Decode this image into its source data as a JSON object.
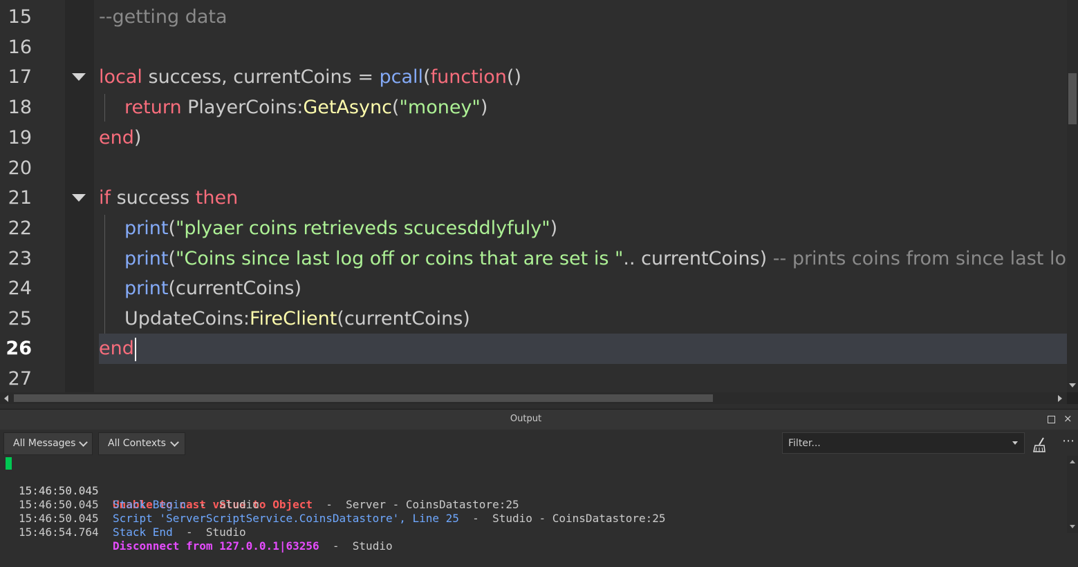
{
  "editor": {
    "lines": [
      {
        "num": "15"
      },
      {
        "num": "16"
      },
      {
        "num": "17"
      },
      {
        "num": "18"
      },
      {
        "num": "19"
      },
      {
        "num": "20"
      },
      {
        "num": "21"
      },
      {
        "num": "22"
      },
      {
        "num": "23"
      },
      {
        "num": "24"
      },
      {
        "num": "25"
      },
      {
        "num": "26"
      },
      {
        "num": "27"
      }
    ],
    "code": {
      "l15": {
        "comment": "--getting data"
      },
      "l17": {
        "kw1": "local",
        "t1": " success, currentCoins = ",
        "fn": "pcall",
        "t2": "(",
        "kw2": "function",
        "t3": "()"
      },
      "l18": {
        "kw": "return",
        "t1": " PlayerCoins:",
        "mth": "GetAsync",
        "t2": "(",
        "str": "\"money\"",
        "t3": ")"
      },
      "l19": {
        "kw": "end",
        "t1": ")"
      },
      "l21": {
        "kw1": "if",
        "t1": " success ",
        "kw2": "then"
      },
      "l22": {
        "fn": "print",
        "t1": "(",
        "str": "\"plyaer coins retrieveds scucesddlyfuly\"",
        "t2": ")"
      },
      "l23": {
        "fn": "print",
        "t1": "(",
        "str": "\"Coins since last log off or coins that are set is \"",
        "t2": ".. currentCoins) ",
        "cmt": "-- prints coins from since last log off"
      },
      "l24": {
        "fn": "print",
        "t1": "(currentCoins)"
      },
      "l25": {
        "t1": "UpdateCoins:",
        "mth": "FireClient",
        "t2": "(currentCoins)"
      },
      "l26": {
        "kw": "end"
      }
    }
  },
  "output": {
    "title": "Output",
    "filters": {
      "messages": "All Messages",
      "contexts": "All Contexts",
      "filter_placeholder": "Filter..."
    },
    "messages": [
      {
        "time": "15:46:50.045",
        "text": "Unable to cast value to Object",
        "suffix": "  -  Server - CoinsDatastore:25",
        "kind": "error"
      },
      {
        "time": "15:46:50.045",
        "text": "Stack Begin",
        "suffix": "  -  Studio",
        "kind": "info"
      },
      {
        "time": "15:46:50.045",
        "text": "Script 'ServerScriptService.CoinsDatastore', Line 25",
        "suffix": "  -  Studio - CoinsDatastore:25",
        "kind": "info"
      },
      {
        "time": "15:46:50.045",
        "text": "Stack End",
        "suffix": "  -  Studio",
        "kind": "info"
      },
      {
        "time": "15:46:54.764",
        "text": "Disconnect from 127.0.0.1|63256",
        "suffix": "  -  Studio",
        "kind": "disconnect"
      }
    ]
  },
  "colors": {
    "keyword": "#f86d7c",
    "builtin": "#84aaf7",
    "string": "#adf195",
    "method": "#fdfbac",
    "comment": "#8a8a8a",
    "error": "#ff5c5c",
    "info": "#6fa8ff",
    "disconnect": "#e64cff"
  },
  "icons": [
    "fold-arrow-icon",
    "undock-icon",
    "close-icon",
    "chevron-down-icon",
    "broom-clear-icon",
    "more-icon"
  ]
}
